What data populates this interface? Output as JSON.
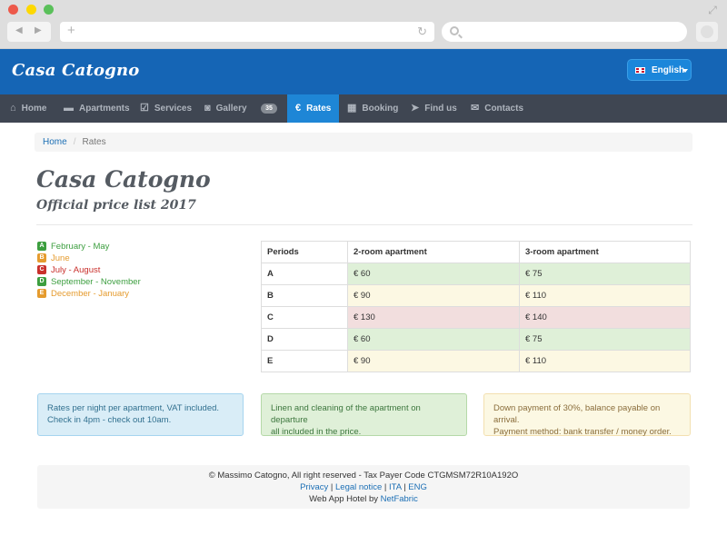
{
  "header": {
    "logo": "Casa Catogno",
    "language_label": "English"
  },
  "nav": {
    "items": [
      {
        "label": "Home",
        "icon": "home-icon"
      },
      {
        "label": "Apartments",
        "icon": "bed-icon"
      },
      {
        "label": "Services",
        "icon": "checkbox-icon"
      },
      {
        "label": "Gallery",
        "icon": "camera-icon",
        "badge": "35"
      },
      {
        "label": "Rates",
        "icon": "euro-icon",
        "active": true
      },
      {
        "label": "Booking",
        "icon": "calendar-icon"
      },
      {
        "label": "Find us",
        "icon": "location-arrow-icon"
      },
      {
        "label": "Contacts",
        "icon": "envelope-icon"
      }
    ]
  },
  "breadcrumb": {
    "home": "Home",
    "current": "Rates"
  },
  "page": {
    "title": "Casa Catogno",
    "subtitle": "Official price list 2017"
  },
  "legend": [
    {
      "code": "A",
      "period": "February - May",
      "color": "#3c9e3f"
    },
    {
      "code": "B",
      "period": "June",
      "color": "#e59b2e"
    },
    {
      "code": "C",
      "period": "July - August",
      "color": "#c9302c"
    },
    {
      "code": "D",
      "period": "September - November",
      "color": "#3c9e3f"
    },
    {
      "code": "E",
      "period": "December - January",
      "color": "#e59b2e"
    }
  ],
  "price_table": {
    "headers": [
      "Periods",
      "2-room apartment",
      "3-room apartment"
    ],
    "rows": [
      {
        "period": "A",
        "two_room": "€ 60",
        "three_room": "€ 75",
        "bg": "#dff0d8"
      },
      {
        "period": "B",
        "two_room": "€ 90",
        "three_room": "€ 110",
        "bg": "#fcf8e3"
      },
      {
        "period": "C",
        "two_room": "€ 130",
        "three_room": "€ 140",
        "bg": "#f2dede"
      },
      {
        "period": "D",
        "two_room": "€ 60",
        "three_room": "€ 75",
        "bg": "#dff0d8"
      },
      {
        "period": "E",
        "two_room": "€ 90",
        "three_room": "€ 110",
        "bg": "#fcf8e3"
      }
    ]
  },
  "info_boxes": [
    {
      "line1": "Rates per night per apartment, VAT included.",
      "line2": "Check in 4pm - check out 10am.",
      "bg": "#d9edf7",
      "border": "#a6d4ef",
      "color": "#31708f"
    },
    {
      "line1": "Linen and cleaning of the apartment on departure",
      "line2": "all included in the price.",
      "bg": "#dff0d8",
      "border": "#b5d9a8",
      "color": "#3c763d"
    },
    {
      "line1": "Down payment of 30%, balance payable on arrival.",
      "line2": "Payment method: bank transfer / money order.",
      "bg": "#fcf8e3",
      "border": "#f3e0b0",
      "color": "#8a6d3b"
    }
  ],
  "footer": {
    "copyright": "© Massimo Catogno, All right reserved - Tax Payer Code CTGMSM72R10A192O",
    "privacy": "Privacy",
    "legal": "Legal notice",
    "ita": "ITA",
    "eng": "ENG",
    "sep": "|",
    "credit_prefix": "Web App Hotel by",
    "credit_link": "NetFabric"
  },
  "colors": {
    "header_bg": "#1565b5",
    "nav_bg": "#3f4652",
    "active_tab": "#1e86d6",
    "link": "#1c6fb5"
  }
}
